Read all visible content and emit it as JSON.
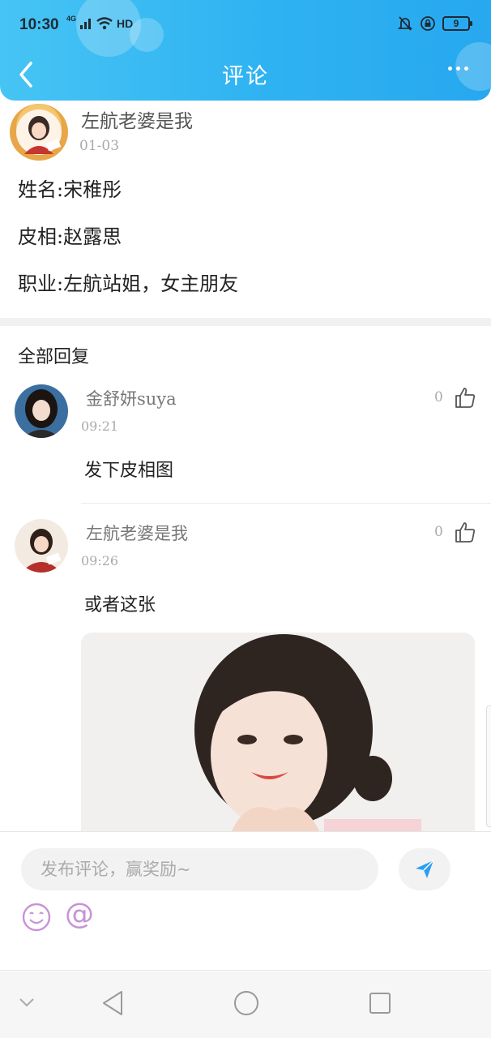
{
  "status_bar": {
    "time": "10:30",
    "network": "4G",
    "wifi_badge": "HD",
    "battery": "9"
  },
  "header": {
    "title": "评论"
  },
  "post": {
    "author": "左航老婆是我",
    "date": "01-03",
    "lines": [
      "姓名:宋稚彤",
      "皮相:赵露思",
      "职业:左航站姐，女主朋友"
    ]
  },
  "replies_section": {
    "title": "全部回复"
  },
  "replies": [
    {
      "name": "金舒妍suya",
      "time": "09:21",
      "text": "发下皮相图",
      "likes": "0"
    },
    {
      "name": "左航老婆是我",
      "time": "09:26",
      "text": "或者这张",
      "likes": "0"
    }
  ],
  "comment_bar": {
    "placeholder": "发布评论，赢奖励~"
  },
  "colors": {
    "header_start": "#46c4f4",
    "header_end": "#27a8ef",
    "send_icon": "#2a9ef0",
    "emoji_icon": "#c892d9"
  }
}
